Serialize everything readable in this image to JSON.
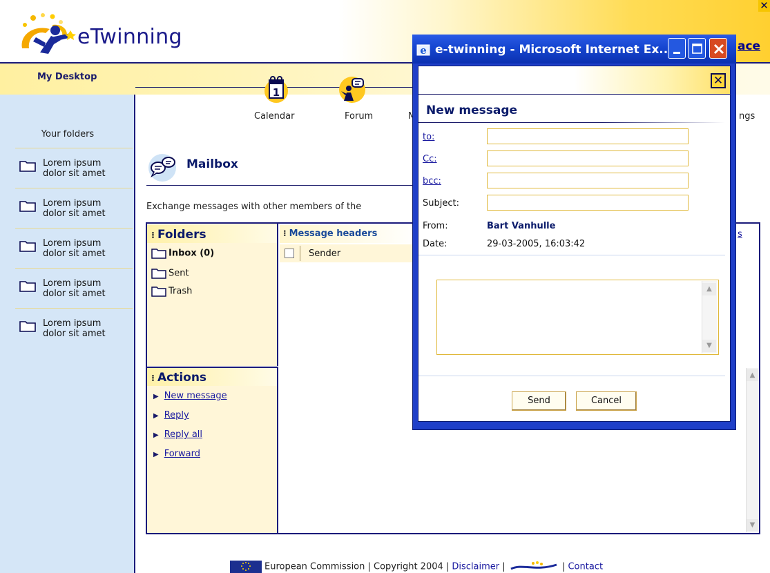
{
  "header": {
    "logo_text": "eTwinning",
    "workspace_link": "ace",
    "close_glyph": "✕"
  },
  "desktop": {
    "title": "My Desktop"
  },
  "nav": {
    "items": [
      {
        "label": "Calendar",
        "icon": "calendar-icon"
      },
      {
        "label": "Forum",
        "icon": "forum-icon"
      }
    ],
    "partial_left": "M",
    "partial_right": "ngs"
  },
  "sidebar": {
    "heading": "Your folders",
    "items": [
      {
        "label_line1": "Lorem ipsum",
        "label_line2": "dolor sit amet"
      },
      {
        "label_line1": "Lorem ipsum",
        "label_line2": "dolor sit amet"
      },
      {
        "label_line1": "Lorem ipsum",
        "label_line2": "dolor sit amet"
      },
      {
        "label_line1": "Lorem ipsum",
        "label_line2": "dolor sit amet"
      },
      {
        "label_line1": "Lorem ipsum",
        "label_line2": "dolor sit amet"
      }
    ]
  },
  "mailbox": {
    "title": "Mailbox",
    "description": "Exchange messages with other members of the",
    "folders": {
      "title": "Folders",
      "items": [
        "Inbox (0)",
        "Sent",
        "Trash"
      ]
    },
    "message_headers": {
      "title": "Message headers",
      "column_sender": "Sender",
      "right_link": "s"
    },
    "actions": {
      "title": "Actions",
      "items": [
        "New message",
        "Reply",
        "Reply all",
        "Forward"
      ]
    }
  },
  "footer": {
    "text1": "European Commission | Copyright 2004 | ",
    "disclaimer": "Disclaimer",
    "sep": " | ",
    "sep2": " | ",
    "contact": "Contact"
  },
  "popup": {
    "window_title": "e-twinning - Microsoft Internet Ex...",
    "heading": "New message",
    "labels": {
      "to": "to:",
      "cc": "Cc:",
      "bcc": "bcc:",
      "subject": "Subject:",
      "from": "From:",
      "date": "Date:"
    },
    "values": {
      "to": "",
      "cc": "",
      "bcc": "",
      "subject": "",
      "from": "Bart Vanhulle",
      "date": "29-03-2005, 16:03:42",
      "body": ""
    },
    "buttons": {
      "send": "Send",
      "cancel": "Cancel"
    }
  },
  "colors": {
    "brand_navy": "#1a1a7a",
    "accent_yellow": "#ffd030",
    "sidebar_blue": "#d5e6f7",
    "panel_cream": "#fff6d8",
    "xp_titlebar": "#1646d0"
  }
}
